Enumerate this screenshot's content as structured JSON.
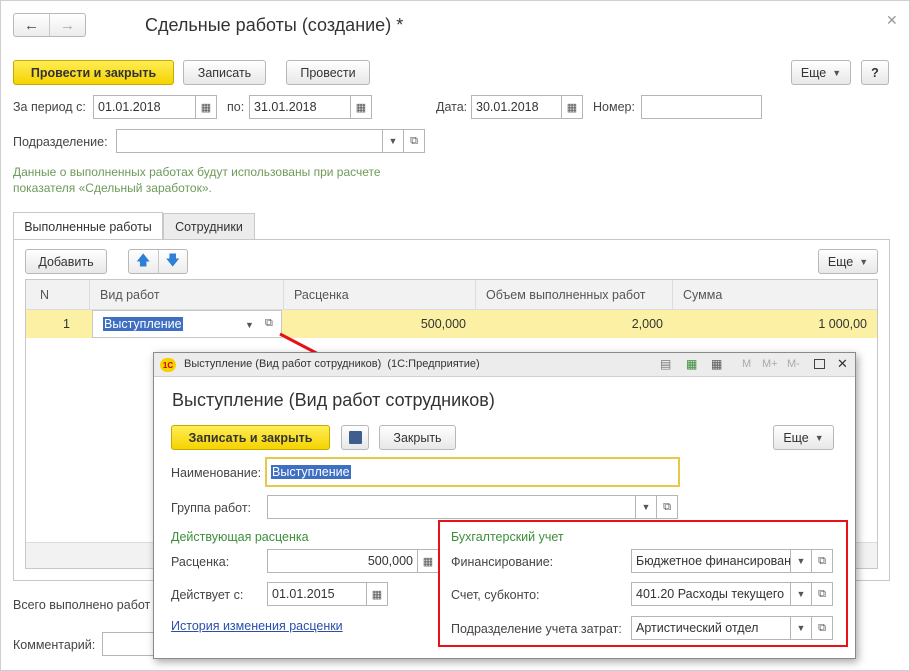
{
  "main": {
    "title": "Сдельные работы (создание) *",
    "buttons": {
      "post_close": "Провести и закрыть",
      "save": "Записать",
      "post": "Провести",
      "more": "Еще",
      "help": "?"
    },
    "period_label": "За период с:",
    "period_from": "01.01.2018",
    "period_to_label": "по:",
    "period_to": "31.01.2018",
    "date_label": "Дата:",
    "date": "30.01.2018",
    "number_label": "Номер:",
    "number": "",
    "department_label": "Подразделение:",
    "department": "",
    "info_line1": "Данные о выполненных работах будут использованы при расчете",
    "info_line2": "показателя «Сдельный заработок».",
    "tabs": [
      "Выполненные работы",
      "Сотрудники"
    ],
    "add_button": "Добавить",
    "more_button": "Еще",
    "columns": [
      "N",
      "Вид работ",
      "Расценка",
      "Объем выполненных работ",
      "Сумма"
    ],
    "row": {
      "n": "1",
      "work_type": "Выступление",
      "rate": "500,000",
      "volume": "2,000",
      "sum": "1 000,00"
    },
    "total_label": "Всего выполнено работ",
    "comment_label": "Комментарий:"
  },
  "popup": {
    "window_title": "Выступление (Вид работ сотрудников)  (1С:Предприятие)",
    "titlebar_tools": [
      "M",
      "M+",
      "M-"
    ],
    "heading": "Выступление (Вид работ сотрудников)",
    "buttons": {
      "save_close": "Записать и закрыть",
      "close": "Закрыть",
      "more": "Еще"
    },
    "name_label": "Наименование:",
    "name_value": "Выступление",
    "group_label": "Группа работ:",
    "group_value": "",
    "rate_section": "Действующая расценка",
    "rate_label": "Расценка:",
    "rate_value": "500,000",
    "valid_label": "Действует с:",
    "valid_value": "01.01.2015",
    "history_link": "История изменения расценки",
    "accounting_section": "Бухгалтерский учет",
    "financing_label": "Финансирование:",
    "financing_value": "Бюджетное финансировани",
    "account_label": "Счет, субконто:",
    "account_value": "401.20 Расходы текущего",
    "cost_dept_label": "Подразделение учета затрат:",
    "cost_dept_value": "Артистический отдел"
  },
  "colors": {
    "accent_yellow": "#f5d300",
    "highlight_blue": "#3f6fc3",
    "section_green": "#3b8f3b",
    "annotation_red": "#e8101a"
  }
}
